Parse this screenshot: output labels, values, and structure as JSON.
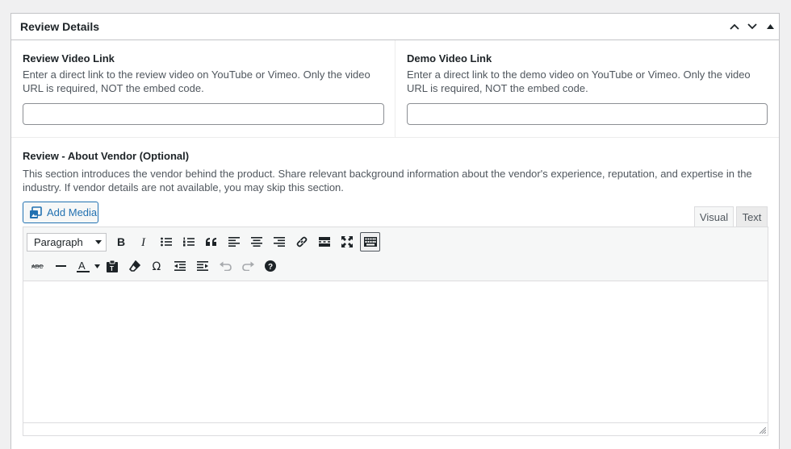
{
  "metabox": {
    "title": "Review Details",
    "controls": {
      "up": "chevron-up-icon",
      "down": "chevron-down-icon",
      "toggle": "caret-up-icon"
    }
  },
  "review_video": {
    "label": "Review Video Link",
    "description": "Enter a direct link to the review video on YouTube or Vimeo. Only the video URL is required, NOT the embed code.",
    "value": ""
  },
  "demo_video": {
    "label": "Demo Video Link",
    "description": "Enter a direct link to the demo video on YouTube or Vimeo. Only the video URL is required, NOT the embed code.",
    "value": ""
  },
  "vendor": {
    "label": "Review - About Vendor (Optional)",
    "description": "This section introduces the vendor behind the product. Share relevant background information about the vendor's experience, reputation, and expertise in the industry. If vendor details are not available, you may skip this section."
  },
  "editor": {
    "add_media_label": "Add Media",
    "tabs": {
      "visual": "Visual",
      "text": "Text"
    },
    "format_select": "Paragraph",
    "content": ""
  },
  "colors": {
    "accent": "#2271b1",
    "border": "#c3c4c7",
    "toolbar_bg": "#f6f7f7"
  }
}
